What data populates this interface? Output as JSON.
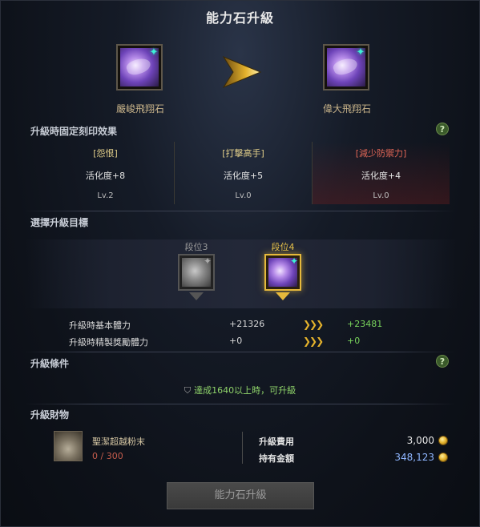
{
  "window": {
    "title": "能力石升級"
  },
  "top": {
    "current_stone": {
      "name": "嚴峻飛翔石"
    },
    "target_stone": {
      "name": "偉大飛翔石"
    }
  },
  "effects_section": {
    "title": "升級時固定刻印效果",
    "help": "?",
    "effects": [
      {
        "name": "[怨恨]",
        "value": "活化度+8",
        "level": "Lv.2",
        "negative": false
      },
      {
        "name": "[打擊高手]",
        "value": "活化度+5",
        "level": "Lv.0",
        "negative": false
      },
      {
        "name": "[減少防禦力]",
        "value": "活化度+4",
        "level": "Lv.0",
        "negative": true
      }
    ]
  },
  "target_section": {
    "title": "選擇升級目標",
    "tiers": [
      {
        "label": "段位3",
        "selected": false
      },
      {
        "label": "段位4",
        "selected": true
      }
    ],
    "stats": [
      {
        "label": "升級時基本體力",
        "current": "+21326",
        "next": "+23481"
      },
      {
        "label": "升級時精製獎勵體力",
        "current": "+0",
        "next": "+0"
      }
    ],
    "arrow_glyph": "❯❯❯"
  },
  "condition_section": {
    "title": "升級條件",
    "help": "?",
    "text": "達成1640以上時，可升級"
  },
  "materials_section": {
    "title": "升級財物",
    "material": {
      "name": "聖潔超越粉末",
      "count": "0 / 300"
    },
    "cost": {
      "label": "升級費用",
      "value": "3,000"
    },
    "owned": {
      "label": "持有金額",
      "value": "348,123"
    }
  },
  "action": {
    "label": "能力石升級"
  },
  "colors": {
    "gold": "#e4b22c",
    "green": "#79d45c",
    "negative": "#e06656",
    "owned_value": "#8fb6ff"
  }
}
